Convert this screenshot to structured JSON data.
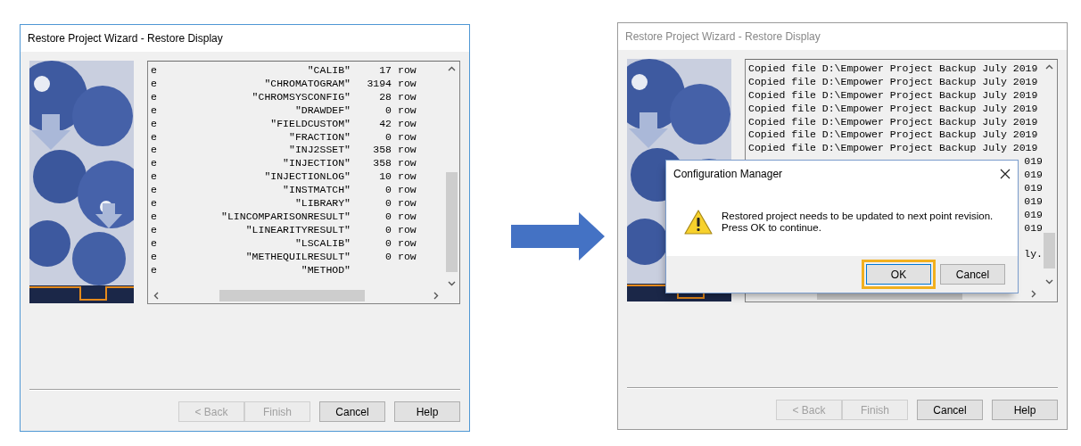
{
  "windows": [
    {
      "title": "Restore Project Wizard - Restore Display",
      "active": true,
      "listing": {
        "kind": "table",
        "rows": [
          {
            "flag": "e",
            "name": "\"CALIB\"",
            "count": "17",
            "unit": "row"
          },
          {
            "flag": "e",
            "name": "\"CHROMATOGRAM\"",
            "count": "3194",
            "unit": "row"
          },
          {
            "flag": "e",
            "name": "\"CHROMSYSCONFIG\"",
            "count": "28",
            "unit": "row"
          },
          {
            "flag": "e",
            "name": "\"DRAWDEF\"",
            "count": "0",
            "unit": "row"
          },
          {
            "flag": "e",
            "name": "\"FIELDCUSTOM\"",
            "count": "42",
            "unit": "row"
          },
          {
            "flag": "e",
            "name": "\"FRACTION\"",
            "count": "0",
            "unit": "row"
          },
          {
            "flag": "e",
            "name": "\"INJ2SSET\"",
            "count": "358",
            "unit": "row"
          },
          {
            "flag": "e",
            "name": "\"INJECTION\"",
            "count": "358",
            "unit": "row"
          },
          {
            "flag": "e",
            "name": "\"INJECTIONLOG\"",
            "count": "10",
            "unit": "row"
          },
          {
            "flag": "e",
            "name": "\"INSTMATCH\"",
            "count": "0",
            "unit": "row"
          },
          {
            "flag": "e",
            "name": "\"LIBRARY\"",
            "count": "0",
            "unit": "row"
          },
          {
            "flag": "e",
            "name": "\"LINCOMPARISONRESULT\"",
            "count": "0",
            "unit": "row"
          },
          {
            "flag": "e",
            "name": "\"LINEARITYRESULT\"",
            "count": "0",
            "unit": "row"
          },
          {
            "flag": "e",
            "name": "\"LSCALIB\"",
            "count": "0",
            "unit": "row"
          },
          {
            "flag": "e",
            "name": "\"METHEQUILRESULT\"",
            "count": "0",
            "unit": "row"
          },
          {
            "flag": "e",
            "name": "\"METHOD\""
          }
        ]
      },
      "buttons": [
        {
          "label": "< Back",
          "disabled": true
        },
        {
          "label": "Finish",
          "disabled": true
        },
        {
          "label": "Cancel",
          "disabled": false
        },
        {
          "label": "Help",
          "disabled": false
        }
      ]
    },
    {
      "title": "Restore Project Wizard - Restore Display",
      "active": false,
      "listing": {
        "kind": "log",
        "lines": [
          {
            "kind": "full",
            "text": "Copied file D:\\Empower Project Backup July 2019"
          },
          {
            "kind": "full",
            "text": "Copied file D:\\Empower Project Backup July 2019"
          },
          {
            "kind": "full",
            "text": "Copied file D:\\Empower Project Backup July 2019"
          },
          {
            "kind": "full",
            "text": "Copied file D:\\Empower Project Backup July 2019"
          },
          {
            "kind": "full",
            "text": "Copied file D:\\Empower Project Backup July 2019"
          },
          {
            "kind": "full",
            "text": "Copied file D:\\Empower Project Backup July 2019"
          },
          {
            "kind": "full",
            "text": "Copied file D:\\Empower Project Backup July 2019"
          },
          {
            "kind": "tail",
            "text": "019"
          },
          {
            "kind": "tail",
            "text": "019"
          },
          {
            "kind": "tail",
            "text": "019"
          },
          {
            "kind": "tail",
            "text": "019"
          },
          {
            "kind": "tail",
            "text": "019"
          },
          {
            "kind": "tail",
            "text": "019"
          },
          {
            "kind": "blank"
          },
          {
            "kind": "tail",
            "text": "ly."
          }
        ]
      },
      "buttons": [
        {
          "label": "< Back",
          "disabled": true
        },
        {
          "label": "Finish",
          "disabled": true
        },
        {
          "label": "Cancel",
          "disabled": false
        },
        {
          "label": "Help",
          "disabled": false
        }
      ],
      "dialog": {
        "title": "Configuration Manager",
        "message_lines": [
          "Restored project needs to be updated to next point revision.",
          "Press OK to continue."
        ],
        "buttons": [
          {
            "label": "OK",
            "highlighted": true
          },
          {
            "label": "Cancel",
            "highlighted": false
          }
        ]
      }
    }
  ]
}
